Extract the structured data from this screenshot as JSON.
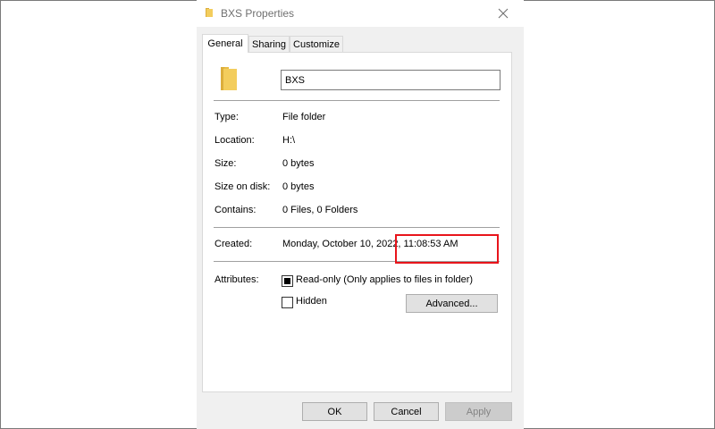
{
  "window": {
    "title": "BXS Properties",
    "close_icon": "close-icon"
  },
  "tabs": [
    {
      "label": "General",
      "active": true
    },
    {
      "label": "Sharing",
      "active": false
    },
    {
      "label": "Customize",
      "active": false
    }
  ],
  "general": {
    "folder_name": "BXS",
    "info": [
      {
        "label": "Type:",
        "value": "File folder"
      },
      {
        "label": "Location:",
        "value": "H:\\"
      },
      {
        "label": "Size:",
        "value": "0 bytes"
      },
      {
        "label": "Size on disk:",
        "value": "0 bytes"
      },
      {
        "label": "Contains:",
        "value": "0 Files, 0 Folders"
      }
    ],
    "created": {
      "label": "Created:",
      "value": "Monday, October 10, 2022, 11:08:53 AM"
    },
    "attributes": {
      "label": "Attributes:",
      "readonly": {
        "label": "Read-only (Only applies to files in folder)",
        "checked": true
      },
      "hidden": {
        "label": "Hidden",
        "checked": false
      },
      "advanced_button": "Advanced..."
    }
  },
  "footer": {
    "ok": "OK",
    "cancel": "Cancel",
    "apply": "Apply"
  },
  "colors": {
    "highlight": "#e8141b",
    "folder": "#f3cd5d"
  }
}
